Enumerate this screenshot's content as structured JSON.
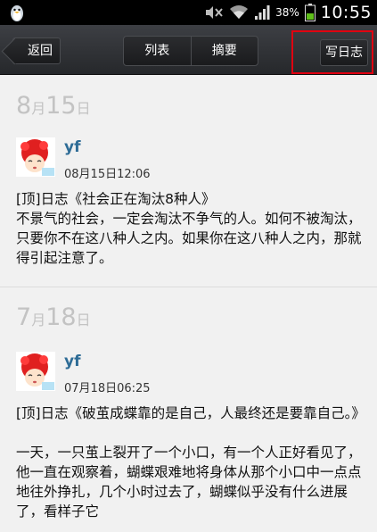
{
  "status_bar": {
    "battery_percent": "38%",
    "time": "10:55",
    "left_icon": "qq-penguin-icon",
    "icons": [
      "mute-icon",
      "wifi-icon",
      "signal-icon",
      "battery-icon"
    ]
  },
  "toolbar": {
    "back_label": "返回",
    "tabs": [
      {
        "label": "列表"
      },
      {
        "label": "摘要"
      }
    ],
    "write_label": "写日志",
    "highlight_color": "#e00010"
  },
  "entries": [
    {
      "date_month": "8",
      "date_month_unit": "月",
      "date_day": "15",
      "date_day_unit": "日",
      "username": "yf",
      "timestamp": "08月15日12:06",
      "title": "[顶]日志《社会正在淘汰8种人》",
      "body": "不景气的社会，一定会淘汰不争气的人。如何不被淘汰，只要你不在这八种人之内。如果你在这八种人之内，那就得引起注意了。"
    },
    {
      "date_month": "7",
      "date_month_unit": "月",
      "date_day": "18",
      "date_day_unit": "日",
      "username": "yf",
      "timestamp": "07月18日06:25",
      "title": "[顶]日志《破茧成蝶靠的是自己，人最终还是要靠自己。》",
      "body": "一天，一只茧上裂开了一个小口，有一个人正好看见了，他一直在观察着，蝴蝶艰难地将身体从那个小口中一点点地往外挣扎，几个小时过去了，蝴蝶似乎没有什么进展了，看样子它"
    }
  ]
}
